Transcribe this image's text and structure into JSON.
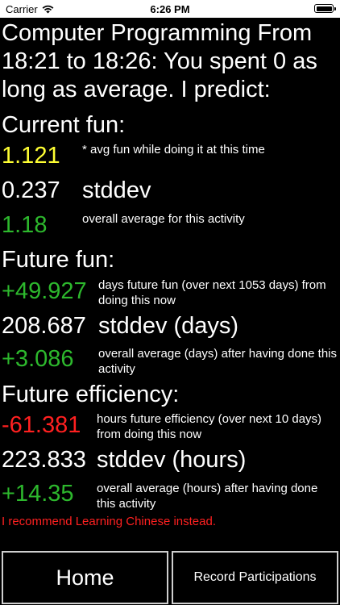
{
  "status_bar": {
    "carrier": "Carrier",
    "time": "6:26 PM",
    "icons": [
      "wifi-icon",
      "battery-icon"
    ]
  },
  "header": {
    "text": "Computer Programming From 18:21 to 18:26: You spent 0 as long as average. I predict:"
  },
  "current_fun": {
    "title": "Current fun:",
    "value": "1.121",
    "value_note": "* avg fun while doing it at this time",
    "stddev": "0.237",
    "stddev_label": "stddev",
    "overall": "1.18",
    "overall_note": "overall average for this activity"
  },
  "future_fun": {
    "title": "Future fun:",
    "value": "+49.927",
    "value_note": "days future fun (over next 1053 days) from doing this now",
    "stddev": "208.687",
    "stddev_label": "stddev (days)",
    "overall": "+3.086",
    "overall_note": "overall average (days) after having done this activity"
  },
  "future_efficiency": {
    "title": "Future efficiency:",
    "value": "-61.381",
    "value_note": "hours future efficiency (over next 10 days) from doing this now",
    "stddev": "223.833",
    "stddev_label": "stddev (hours)",
    "overall": "+14.35",
    "overall_note": "overall average (hours) after having done this activity"
  },
  "recommendation": "I recommend Learning Chinese instead.",
  "buttons": {
    "home": "Home",
    "record": "Record Participations"
  },
  "colors": {
    "background": "#000000",
    "text": "#ffffff",
    "current_value": "#ffff33",
    "positive": "#2db82d",
    "negative": "#ff2020",
    "button_border": "#cfcfcf"
  }
}
